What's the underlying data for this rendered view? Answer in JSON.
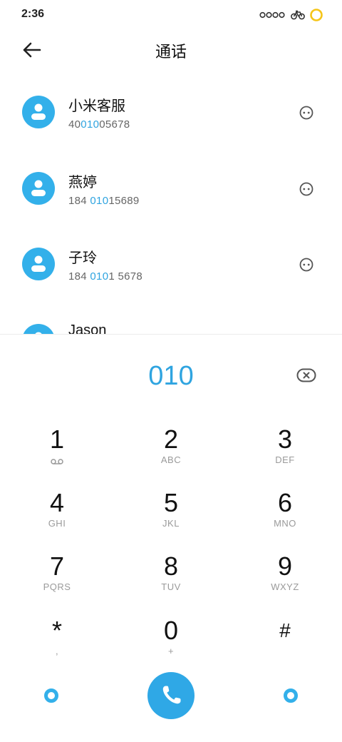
{
  "status_bar": {
    "time": "2:36"
  },
  "header": {
    "title": "通话"
  },
  "contacts": [
    {
      "name": "小米客服",
      "number_parts": [
        "40",
        "010",
        "05678"
      ]
    },
    {
      "name": "燕婷",
      "number_parts": [
        "184 ",
        "010",
        "15689"
      ]
    },
    {
      "name": "子玲",
      "number_parts": [
        "184 ",
        "010",
        "1 5678"
      ]
    },
    {
      "name": "Jason"
    }
  ],
  "dialer": {
    "input": "010"
  },
  "keypad": [
    {
      "digit": "1",
      "letters": ""
    },
    {
      "digit": "2",
      "letters": "ABC"
    },
    {
      "digit": "3",
      "letters": "DEF"
    },
    {
      "digit": "4",
      "letters": "GHI"
    },
    {
      "digit": "5",
      "letters": "JKL"
    },
    {
      "digit": "6",
      "letters": "MNO"
    },
    {
      "digit": "7",
      "letters": "PQRS"
    },
    {
      "digit": "8",
      "letters": "TUV"
    },
    {
      "digit": "9",
      "letters": "WXYZ"
    },
    {
      "digit": "*",
      "letters": ","
    },
    {
      "digit": "0",
      "letters": "+"
    },
    {
      "digit": "#",
      "letters": ""
    }
  ],
  "icons": {
    "back": "arrow-left-icon",
    "more": "more-dots-icon",
    "backspace": "backspace-icon",
    "voicemail": "voicemail-icon",
    "call": "phone-icon"
  },
  "colors": {
    "accent": "#2fa8e6",
    "avatar": "#33b0ea",
    "highlight": "#2fa4e0"
  }
}
